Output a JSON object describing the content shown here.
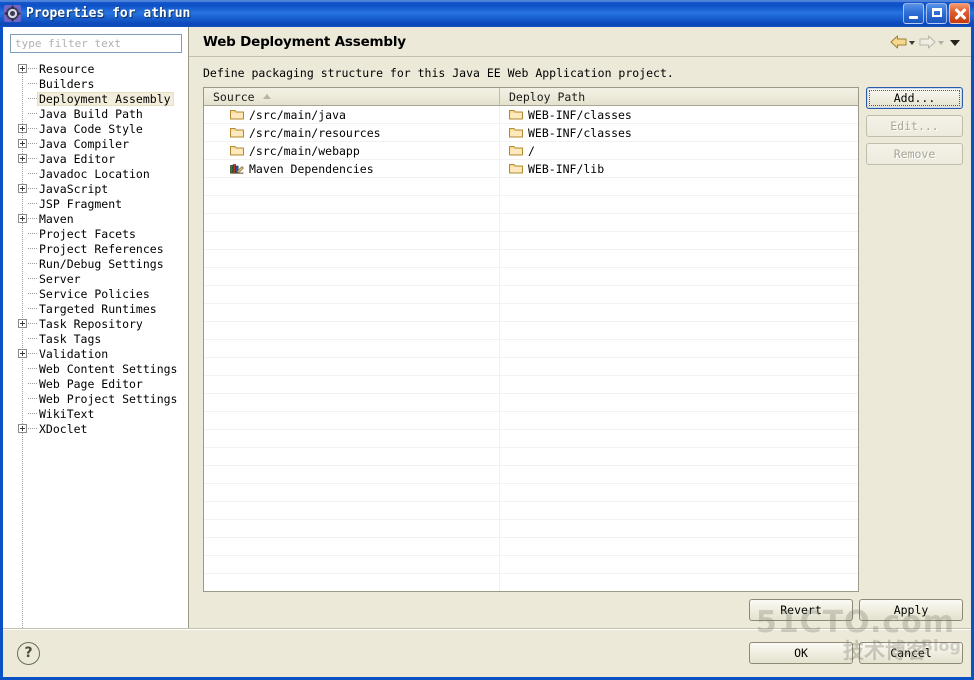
{
  "window": {
    "title": "Properties for athrun",
    "icon": "properties-gear-icon",
    "buttons": {
      "minimize": "minimize-button",
      "maximize": "maximize-button",
      "close": "close-button"
    }
  },
  "sidebar": {
    "filter": {
      "value": "",
      "placeholder": "type filter text"
    },
    "items": [
      {
        "label": "Resource",
        "expandable": true,
        "selected": false
      },
      {
        "label": "Builders",
        "expandable": false,
        "selected": false
      },
      {
        "label": "Deployment Assembly",
        "expandable": false,
        "selected": true
      },
      {
        "label": "Java Build Path",
        "expandable": false,
        "selected": false
      },
      {
        "label": "Java Code Style",
        "expandable": true,
        "selected": false
      },
      {
        "label": "Java Compiler",
        "expandable": true,
        "selected": false
      },
      {
        "label": "Java Editor",
        "expandable": true,
        "selected": false
      },
      {
        "label": "Javadoc Location",
        "expandable": false,
        "selected": false
      },
      {
        "label": "JavaScript",
        "expandable": true,
        "selected": false
      },
      {
        "label": "JSP Fragment",
        "expandable": false,
        "selected": false
      },
      {
        "label": "Maven",
        "expandable": true,
        "selected": false
      },
      {
        "label": "Project Facets",
        "expandable": false,
        "selected": false
      },
      {
        "label": "Project References",
        "expandable": false,
        "selected": false
      },
      {
        "label": "Run/Debug Settings",
        "expandable": false,
        "selected": false
      },
      {
        "label": "Server",
        "expandable": false,
        "selected": false
      },
      {
        "label": "Service Policies",
        "expandable": false,
        "selected": false
      },
      {
        "label": "Targeted Runtimes",
        "expandable": false,
        "selected": false
      },
      {
        "label": "Task Repository",
        "expandable": true,
        "selected": false
      },
      {
        "label": "Task Tags",
        "expandable": false,
        "selected": false
      },
      {
        "label": "Validation",
        "expandable": true,
        "selected": false
      },
      {
        "label": "Web Content Settings",
        "expandable": false,
        "selected": false
      },
      {
        "label": "Web Page Editor",
        "expandable": false,
        "selected": false
      },
      {
        "label": "Web Project Settings",
        "expandable": false,
        "selected": false
      },
      {
        "label": "WikiText",
        "expandable": false,
        "selected": false
      },
      {
        "label": "XDoclet",
        "expandable": true,
        "selected": false
      }
    ]
  },
  "page": {
    "title": "Web Deployment Assembly",
    "description": "Define packaging structure for this Java EE Web Application project.",
    "nav": {
      "back_icon": "back-arrow-icon",
      "back_menu_icon": "chevron-down-icon",
      "forward_icon": "forward-arrow-icon",
      "forward_menu_icon": "chevron-down-icon",
      "view_menu_icon": "chevron-down-icon"
    }
  },
  "table": {
    "columns": [
      {
        "label": "Source",
        "sorted": "asc",
        "sort_icon": "sort-ascending-icon"
      },
      {
        "label": "Deploy Path",
        "sorted": "",
        "sort_icon": ""
      }
    ],
    "rows": [
      {
        "source": "/src/main/java",
        "source_icon": "folder-icon",
        "deploy": "WEB-INF/classes",
        "deploy_icon": "folder-icon"
      },
      {
        "source": "/src/main/resources",
        "source_icon": "folder-icon",
        "deploy": "WEB-INF/classes",
        "deploy_icon": "folder-icon"
      },
      {
        "source": "/src/main/webapp",
        "source_icon": "folder-icon",
        "deploy": "/",
        "deploy_icon": "folder-icon"
      },
      {
        "source": "Maven Dependencies",
        "source_icon": "library-icon",
        "deploy": "WEB-INF/lib",
        "deploy_icon": "folder-icon"
      }
    ],
    "empty_row_count": 24
  },
  "side_buttons": [
    {
      "label": "Add...",
      "mnemonic": "d",
      "enabled": true,
      "focused": true
    },
    {
      "label": "Edit...",
      "mnemonic": "E",
      "enabled": false,
      "focused": false
    },
    {
      "label": "Remove",
      "mnemonic": "R",
      "enabled": false,
      "focused": false
    }
  ],
  "apply_buttons": [
    {
      "label": "Revert",
      "enabled": true
    },
    {
      "label": "Apply",
      "enabled": true
    }
  ],
  "footer": {
    "help_icon": "help-question-icon",
    "buttons": [
      {
        "label": "OK",
        "enabled": true
      },
      {
        "label": "Cancel",
        "enabled": true
      }
    ]
  },
  "watermark": {
    "top": "51CTO.com",
    "bottom": "技术博客",
    "blog": "Blog"
  },
  "colors": {
    "titlebar_blue": "#0a52c4",
    "dialog_face": "#ece9d8",
    "selection": "#f3eedc",
    "folder": "#fbd88a",
    "border": "#9a9a86"
  }
}
